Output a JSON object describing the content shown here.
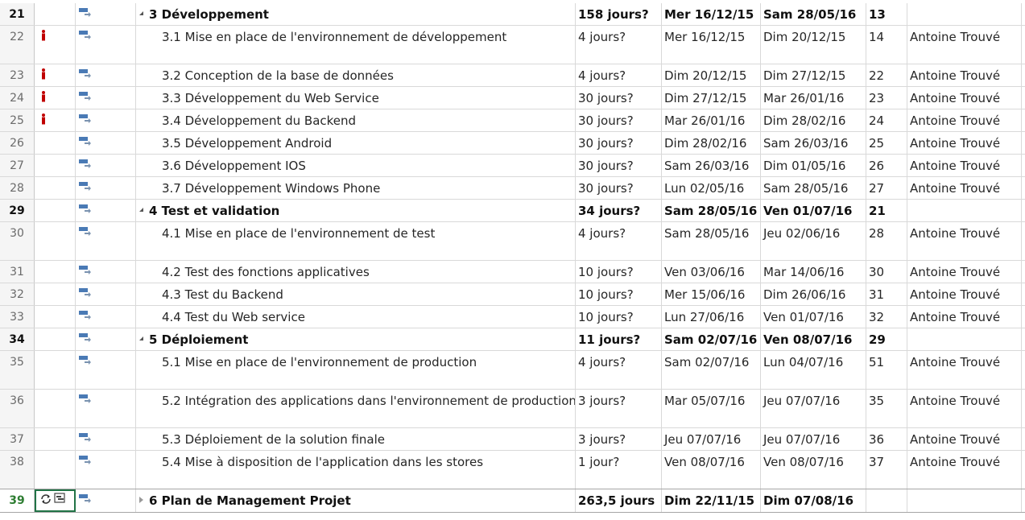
{
  "colors": {
    "mode_icon": "#4a7ab5",
    "person_icon": "#c00000",
    "selection": "#217346",
    "grid": "#d9d9d9"
  },
  "icons": {
    "mode": "auto-scheduled-task-icon",
    "indicator": "person-resource-icon",
    "recurring": "recurring-task-icon",
    "subproject": "inserted-project-icon"
  },
  "rows": [
    {
      "id": "21",
      "name": "3 Développement",
      "duration": "158 jours?",
      "start": "Mer 16/12/15",
      "end": "Sam 28/05/16",
      "pred": "13",
      "resource": "",
      "summary": true,
      "indicator": false,
      "tall": false
    },
    {
      "id": "22",
      "name": "3.1 Mise en place de l'environnement de développement",
      "duration": "4 jours?",
      "start": "Mer 16/12/15",
      "end": "Dim 20/12/15",
      "pred": "14",
      "resource": "Antoine Trouvé",
      "summary": false,
      "indicator": true,
      "tall": true
    },
    {
      "id": "23",
      "name": "3.2 Conception de la base de données",
      "duration": "4 jours?",
      "start": "Dim 20/12/15",
      "end": "Dim 27/12/15",
      "pred": "22",
      "resource": "Antoine Trouvé",
      "summary": false,
      "indicator": true,
      "tall": false
    },
    {
      "id": "24",
      "name": "3.3 Développement du Web Service",
      "duration": "30 jours?",
      "start": "Dim 27/12/15",
      "end": "Mar 26/01/16",
      "pred": "23",
      "resource": "Antoine Trouvé",
      "summary": false,
      "indicator": true,
      "tall": false
    },
    {
      "id": "25",
      "name": "3.4 Développement du Backend",
      "duration": "30 jours?",
      "start": "Mar 26/01/16",
      "end": "Dim 28/02/16",
      "pred": "24",
      "resource": "Antoine Trouvé",
      "summary": false,
      "indicator": true,
      "tall": false
    },
    {
      "id": "26",
      "name": "3.5 Développement Android",
      "duration": "30 jours?",
      "start": "Dim 28/02/16",
      "end": "Sam 26/03/16",
      "pred": "25",
      "resource": "Antoine Trouvé",
      "summary": false,
      "indicator": false,
      "tall": false
    },
    {
      "id": "27",
      "name": "3.6 Développement IOS",
      "duration": "30 jours?",
      "start": "Sam 26/03/16",
      "end": "Dim 01/05/16",
      "pred": "26",
      "resource": "Antoine Trouvé",
      "summary": false,
      "indicator": false,
      "tall": false
    },
    {
      "id": "28",
      "name": "3.7 Développement Windows Phone",
      "duration": "30 jours?",
      "start": "Lun 02/05/16",
      "end": "Sam 28/05/16",
      "pred": "27",
      "resource": "Antoine Trouvé",
      "summary": false,
      "indicator": false,
      "tall": false
    },
    {
      "id": "29",
      "name": "4 Test et validation",
      "duration": "34 jours?",
      "start": "Sam 28/05/16",
      "end": "Ven 01/07/16",
      "pred": "21",
      "resource": "",
      "summary": true,
      "indicator": false,
      "tall": false
    },
    {
      "id": "30",
      "name": "4.1 Mise en place de l'environnement de test",
      "duration": "4 jours?",
      "start": "Sam 28/05/16",
      "end": "Jeu 02/06/16",
      "pred": "28",
      "resource": "Antoine Trouvé",
      "summary": false,
      "indicator": false,
      "tall": true
    },
    {
      "id": "31",
      "name": "4.2 Test des fonctions applicatives",
      "duration": "10 jours?",
      "start": "Ven 03/06/16",
      "end": "Mar 14/06/16",
      "pred": "30",
      "resource": "Antoine Trouvé",
      "summary": false,
      "indicator": false,
      "tall": false
    },
    {
      "id": "32",
      "name": "4.3 Test du Backend",
      "duration": "10 jours?",
      "start": "Mer 15/06/16",
      "end": "Dim 26/06/16",
      "pred": "31",
      "resource": "Antoine Trouvé",
      "summary": false,
      "indicator": false,
      "tall": false
    },
    {
      "id": "33",
      "name": "4.4 Test du Web service",
      "duration": "10 jours?",
      "start": "Lun 27/06/16",
      "end": "Ven 01/07/16",
      "pred": "32",
      "resource": "Antoine Trouvé",
      "summary": false,
      "indicator": false,
      "tall": false
    },
    {
      "id": "34",
      "name": "5 Déploiement",
      "duration": "11 jours?",
      "start": "Sam 02/07/16",
      "end": "Ven 08/07/16",
      "pred": "29",
      "resource": "",
      "summary": true,
      "indicator": false,
      "tall": false
    },
    {
      "id": "35",
      "name": "5.1 Mise en place de l'environnement de production",
      "duration": "4 jours?",
      "start": "Sam 02/07/16",
      "end": "Lun 04/07/16",
      "pred": "51",
      "resource": "Antoine Trouvé",
      "summary": false,
      "indicator": false,
      "tall": true
    },
    {
      "id": "36",
      "name": "5.2 Intégration des applications dans l'environnement de production",
      "duration": "3 jours?",
      "start": "Mar 05/07/16",
      "end": "Jeu 07/07/16",
      "pred": "35",
      "resource": "Antoine Trouvé",
      "summary": false,
      "indicator": false,
      "tall": true
    },
    {
      "id": "37",
      "name": "5.3 Déploiement de la solution finale",
      "duration": "3 jours?",
      "start": "Jeu 07/07/16",
      "end": "Jeu 07/07/16",
      "pred": "36",
      "resource": "Antoine Trouvé",
      "summary": false,
      "indicator": false,
      "tall": false
    },
    {
      "id": "38",
      "name": "5.4 Mise à disposition de l'application dans les stores",
      "duration": "1 jour?",
      "start": "Ven 08/07/16",
      "end": "Ven 08/07/16",
      "pred": "37",
      "resource": "Antoine Trouvé",
      "summary": false,
      "indicator": false,
      "tall": true
    },
    {
      "id": "39",
      "name": "6 Plan de Management Projet",
      "duration": "263,5 jours",
      "start": "Dim 22/11/15",
      "end": "Dim 07/08/16",
      "pred": "",
      "resource": "",
      "summary": true,
      "indicator": false,
      "tall": false,
      "collapsed": true,
      "selected": true
    }
  ]
}
